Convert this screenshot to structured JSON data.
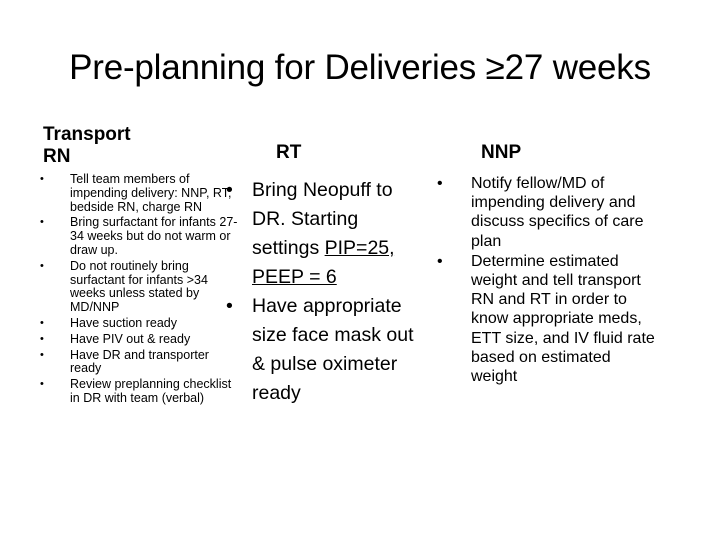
{
  "slide": {
    "title": "Pre-planning for Deliveries ≥27 weeks"
  },
  "columns": {
    "transport_rn": {
      "heading_line1": "Transport",
      "heading_line2": "RN",
      "items": [
        "Tell team members of impending delivery: NNP, RT, bedside RN, charge RN",
        "Bring surfactant for infants 27-34 weeks but do not warm or draw up.",
        "Do not routinely bring surfactant for infants >34 weeks unless stated by MD/NNP",
        "Have suction ready",
        "Have PIV out & ready",
        "Have DR and transporter ready",
        "Review preplanning checklist in DR with team (verbal)"
      ]
    },
    "rt": {
      "heading": "RT",
      "items": [
        {
          "text_before": "Bring Neopuff to DR.  Starting settings ",
          "underlined": "PIP=25, PEEP = 6",
          "text_after": ""
        },
        {
          "text_before": "Have appropriate size face mask out & pulse oximeter ready",
          "underlined": "",
          "text_after": ""
        }
      ]
    },
    "nnp": {
      "heading": "NNP",
      "items": [
        "Notify fellow/MD of impending delivery and discuss specifics of care plan",
        "Determine estimated weight and tell transport RN and RT in order to know appropriate meds, ETT size, and IV fluid rate based on estimated weight"
      ]
    }
  },
  "bullet_glyph": "•"
}
